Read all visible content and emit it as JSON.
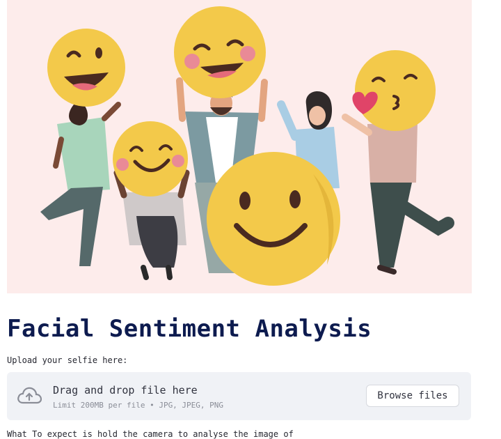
{
  "hero": {
    "image": "people-holding-emoji-faces-illustration",
    "background": "#fdeceb"
  },
  "page": {
    "title": "Facial Sentiment Analysis"
  },
  "uploader": {
    "label": "Upload your selfie here:",
    "drop_title": "Drag and drop file here",
    "limit_text": "Limit 200MB per file • JPG, JPEG, PNG",
    "browse_label": "Browse files",
    "icon": "cloud-upload-icon"
  },
  "footer": {
    "partial_text": "What To expect is hold the camera to analyse the image of"
  },
  "colors": {
    "title": "#0d1b4f",
    "dropzone": "#f0f2f6",
    "emoji": "#f3c94a"
  }
}
